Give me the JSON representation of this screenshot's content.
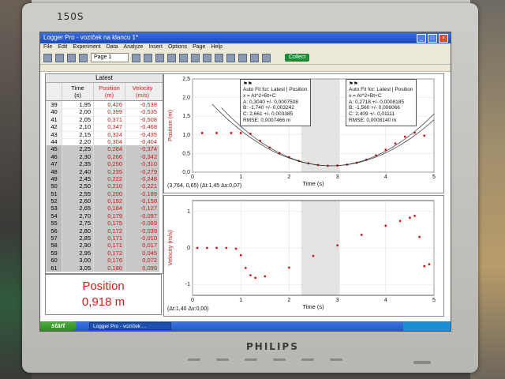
{
  "monitor": {
    "model": "150S",
    "brand": "PHILIPS"
  },
  "window": {
    "title": "Logger Pro - vozíček na klancu 1*"
  },
  "menu": [
    "File",
    "Edit",
    "Experiment",
    "Data",
    "Analyze",
    "Insert",
    "Options",
    "Page",
    "Help"
  ],
  "toolbar": {
    "page": "Page 1",
    "collect": "Collect"
  },
  "table": {
    "header": "Latest",
    "columns": [
      {
        "name": "Time",
        "unit": "(s)"
      },
      {
        "name": "Position",
        "unit": "(m)"
      },
      {
        "name": "Velocity",
        "unit": "(m/s)"
      }
    ],
    "rows": [
      [
        "39",
        "1,95",
        "0,426",
        "-0,538"
      ],
      [
        "40",
        "2,00",
        "0,399",
        "-0,535"
      ],
      [
        "41",
        "2,05",
        "0,371",
        "-0,508"
      ],
      [
        "42",
        "2,10",
        "0,347",
        "-0,468"
      ],
      [
        "43",
        "2,15",
        "0,324",
        "-0,435"
      ],
      [
        "44",
        "2,20",
        "0,304",
        "-0,404"
      ],
      [
        "45",
        "2,25",
        "0,284",
        "-0,374"
      ],
      [
        "46",
        "2,30",
        "0,266",
        "-0,342"
      ],
      [
        "47",
        "2,35",
        "0,250",
        "-0,310"
      ],
      [
        "48",
        "2,40",
        "0,235",
        "-0,279"
      ],
      [
        "49",
        "2,45",
        "0,222",
        "-0,248"
      ],
      [
        "50",
        "2,50",
        "0,210",
        "-0,221"
      ],
      [
        "51",
        "2,55",
        "0,200",
        "-0,189"
      ],
      [
        "52",
        "2,60",
        "0,192",
        "-0,158"
      ],
      [
        "53",
        "2,65",
        "0,184",
        "-0,127"
      ],
      [
        "54",
        "2,70",
        "0,179",
        "-0,097"
      ],
      [
        "55",
        "2,75",
        "0,175",
        "-0,069"
      ],
      [
        "56",
        "2,80",
        "0,172",
        "-0,039"
      ],
      [
        "57",
        "2,85",
        "0,171",
        "-0,010"
      ],
      [
        "58",
        "2,90",
        "0,171",
        "0,017"
      ],
      [
        "59",
        "2,95",
        "0,172",
        "0,045"
      ],
      [
        "60",
        "3,00",
        "0,176",
        "0,072"
      ],
      [
        "61",
        "3,05",
        "0,180",
        "0,099"
      ]
    ]
  },
  "display": {
    "line1": "Position",
    "line2": "0,918 m"
  },
  "graph1": {
    "ylabel": "Position (m)",
    "xlabel": "Time (s)",
    "yticks": [
      "2,5",
      "2,0",
      "1,5",
      "1,0",
      "0,5",
      "0,0"
    ],
    "xticks": [
      "0",
      "1",
      "2",
      "3",
      "4",
      "5"
    ],
    "readout": "(3,764, 0,65)  (Δt:1,45  Δx:0,07)",
    "fit1": {
      "title": "Auto Fit for: Latest | Position",
      "eq": "x = At^2+Bt+C",
      "a": "A: 0,3040 +/- 0,0007508",
      "b": "B: -1,740 +/- 0,003242",
      "c": "C: 2,661 +/- 0,003385",
      "rmse": "RMSE: 0,0007466 m"
    },
    "fit2": {
      "title": "Auto Fit for: Latest | Position",
      "eq": "x = At^2+Bt+C",
      "a": "A: 0,2718 +/- 0,0008185",
      "b": "B: -1,560 +/- 0,006066",
      "c": "C: 2,409 +/- 0,01111",
      "rmse": "RMSE: 0,0008140 m"
    }
  },
  "graph2": {
    "ylabel": "Velocity (m/s)",
    "xlabel": "Time (s)",
    "yticks": [
      "1",
      "0",
      "-1"
    ],
    "xticks": [
      "0",
      "1",
      "2",
      "3",
      "4",
      "5"
    ],
    "readout": "(Δt:1,40  Δv:0,00)"
  },
  "taskbar": {
    "start": "start",
    "task": "Logger Pro - vozíček ..."
  },
  "chart_data": [
    {
      "type": "scatter",
      "ylabel": "Position (m)",
      "xlabel": "Time (s)",
      "xlim": [
        0,
        5
      ],
      "ylim": [
        0,
        2.5
      ],
      "x": [
        0.2,
        0.5,
        0.8,
        1.0,
        1.2,
        1.4,
        1.6,
        1.8,
        2.0,
        2.2,
        2.4,
        2.6,
        2.8,
        3.0,
        3.2,
        3.4,
        3.6,
        3.8,
        4.0,
        4.2,
        4.4,
        4.6,
        4.8
      ],
      "y": [
        1.05,
        1.05,
        1.05,
        1.05,
        1.03,
        0.84,
        0.66,
        0.51,
        0.4,
        0.3,
        0.235,
        0.19,
        0.172,
        0.176,
        0.2,
        0.25,
        0.33,
        0.45,
        0.6,
        0.77,
        0.95,
        1.06,
        0.98
      ]
    },
    {
      "type": "scatter",
      "ylabel": "Velocity (m/s)",
      "xlabel": "Time (s)",
      "xlim": [
        0,
        5
      ],
      "ylim": [
        -1.3,
        1.3
      ],
      "x": [
        0.1,
        0.3,
        0.5,
        0.7,
        0.9,
        1.0,
        1.1,
        1.2,
        1.3,
        1.5,
        2.0,
        2.5,
        3.0,
        3.5,
        4.0,
        4.3,
        4.5,
        4.6,
        4.7,
        4.8,
        4.9
      ],
      "y": [
        0,
        0,
        0,
        0,
        -0.02,
        -0.2,
        -0.55,
        -0.75,
        -0.82,
        -0.78,
        -0.54,
        -0.22,
        0.07,
        0.36,
        0.61,
        0.74,
        0.83,
        0.88,
        0.3,
        -0.5,
        -0.45
      ]
    }
  ]
}
